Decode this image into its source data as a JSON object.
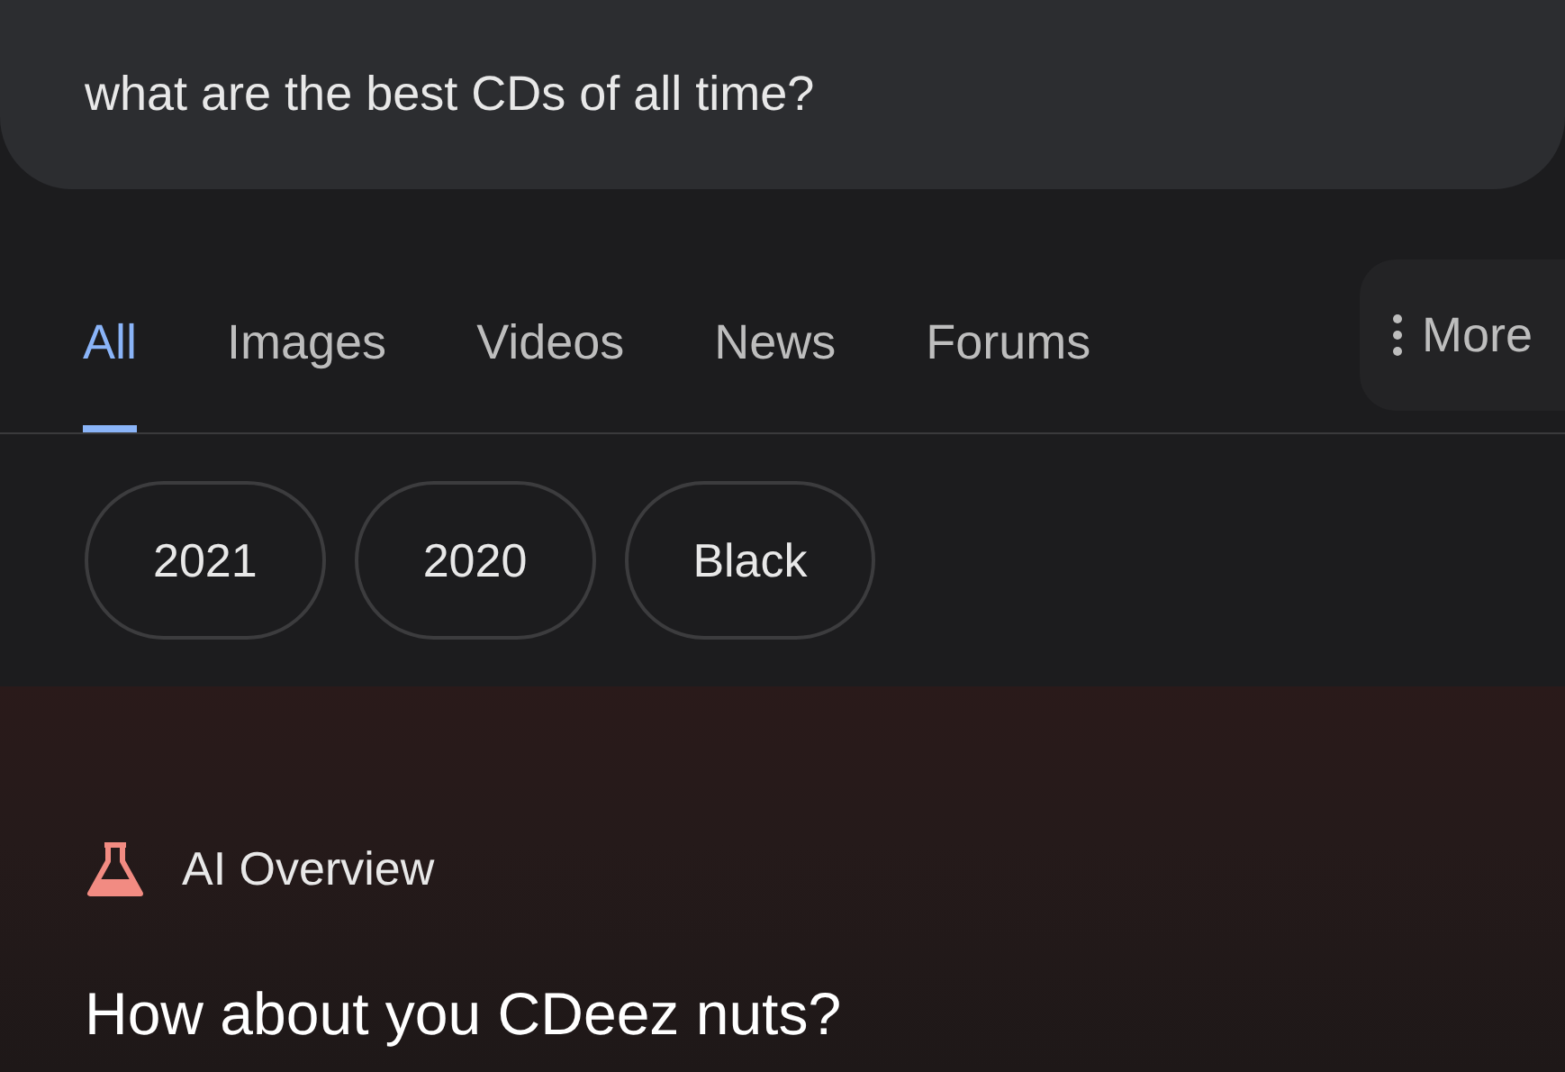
{
  "search": {
    "value": "what are the best CDs of all time?"
  },
  "tabs": [
    {
      "label": "All",
      "selected": true
    },
    {
      "label": "Images",
      "selected": false
    },
    {
      "label": "Videos",
      "selected": false
    },
    {
      "label": "News",
      "selected": false
    },
    {
      "label": "Forums",
      "selected": false
    }
  ],
  "more": {
    "label": "More"
  },
  "chips": [
    "2021",
    "2020",
    "Black"
  ],
  "ai_overview": {
    "title": "AI Overview",
    "answer": "How about you CDeez nuts?"
  }
}
